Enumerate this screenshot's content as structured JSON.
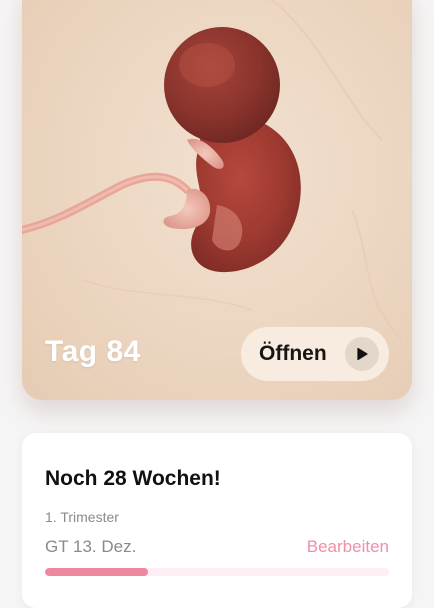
{
  "hero": {
    "day_label": "Tag 84",
    "open_label": "Öffnen",
    "image_icon": "embryo-illustration",
    "play_icon": "play-icon"
  },
  "pregnancy": {
    "countdown": "Noch 28 Wochen!",
    "trimester": "1. Trimester",
    "due_date": "GT 13. Dez.",
    "edit_label": "Bearbeiten",
    "progress_fraction": 0.3
  },
  "colors": {
    "accent": "#ef87a0",
    "link": "#ef8fa8",
    "hero_background": "#ecd6c1"
  }
}
